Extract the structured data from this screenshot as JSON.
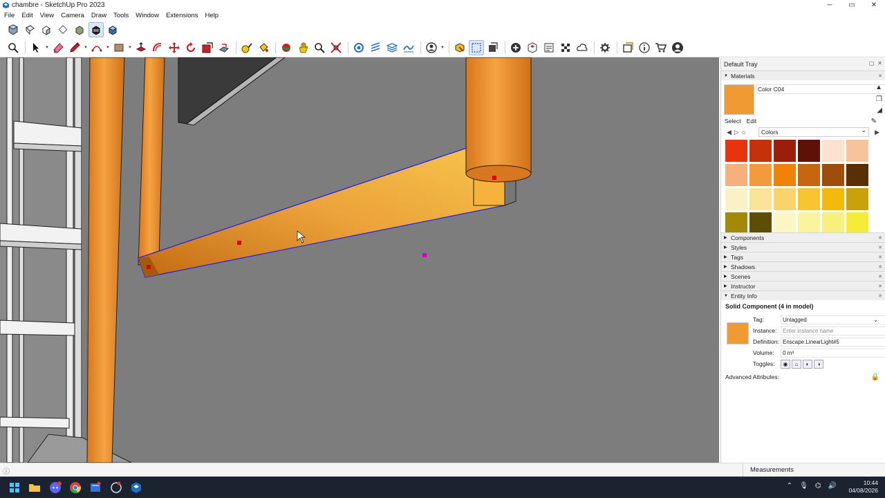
{
  "window": {
    "title": "chambre - SketchUp Pro 2023",
    "minimize": "─",
    "maximize": "▭",
    "close": "✕"
  },
  "menu": [
    "File",
    "Edit",
    "View",
    "Camera",
    "Draw",
    "Tools",
    "Window",
    "Extensions",
    "Help"
  ],
  "colors": {
    "accent_orange": "#f09a34",
    "viewport_bg": "#7d7d7d",
    "selection_blue": "#1a1aff",
    "taskbar": "#1b2331"
  },
  "toolbar_top": [
    "views-iso-icon",
    "views-top-icon",
    "views-front-icon",
    "views-right-icon",
    "views-back-icon",
    "views-left-icon",
    "views-bottom-icon"
  ],
  "toolbar_main": [
    "zoom-icon",
    "select-icon",
    "eraser-icon",
    "pencil-icon",
    "arc-icon",
    "rectangle-icon",
    "push-pull-icon",
    "offset-icon",
    "move-icon",
    "rotate-icon",
    "scale-icon",
    "follow-me-icon",
    "tape-measure-icon",
    "paint-bucket-icon",
    "orbit-icon",
    "pan-icon",
    "zoom-window-icon",
    "zoom-extents-icon",
    "x-ray-icon",
    "section-icon",
    "layers-icon",
    "sandbox-icon",
    "user-icon",
    "components-icon",
    "select-box-icon",
    "model-info-icon",
    "add-icon",
    "warehouse-icon",
    "extension-manager-icon",
    "checker-icon",
    "cloud-icon",
    "settings-icon",
    "window-icon",
    "info-icon",
    "cart-icon",
    "account-icon"
  ],
  "tray": {
    "title": "Default Tray",
    "materials_header": "Materials",
    "material_name": "Color C04",
    "tab_select": "Select",
    "tab_edit": "Edit",
    "library": "Colors",
    "swatch_colors": [
      "#e8340e",
      "#c4310a",
      "#9a1e08",
      "#5e1206",
      "#fbe3cf",
      "#f7c39b",
      "#f6b07c",
      "#f39a3c",
      "#f08208",
      "#c76511",
      "#9e4e0c",
      "#5a2f05",
      "#fcf1c6",
      "#fae49a",
      "#f9d46b",
      "#f8c42f",
      "#f3b90c",
      "#c9a20a",
      "#a48808",
      "#5e4e04",
      "#fbf6c4",
      "#fbf39e",
      "#f8f07c",
      "#f6eb36"
    ],
    "panels": [
      "Components",
      "Styles",
      "Tags",
      "Shadows",
      "Scenes",
      "Instructor"
    ],
    "entity_info_header": "Entity Info",
    "entity": {
      "heading": "Solid Component (4 in model)",
      "tag_label": "Tag:",
      "tag_value": "Untagged",
      "instance_label": "Instance:",
      "instance_placeholder": "Enter instance name",
      "definition_label": "Definition:",
      "definition_value": "Enscape.LinearLight#5",
      "volume_label": "Volume:",
      "volume_value": "0 m³",
      "toggles_label": "Toggles:",
      "advanced": "Advanced Attributes:"
    }
  },
  "status": {
    "measurements": "Measurements"
  },
  "clock": {
    "time": "10:44",
    "date": "04/08/2026"
  }
}
